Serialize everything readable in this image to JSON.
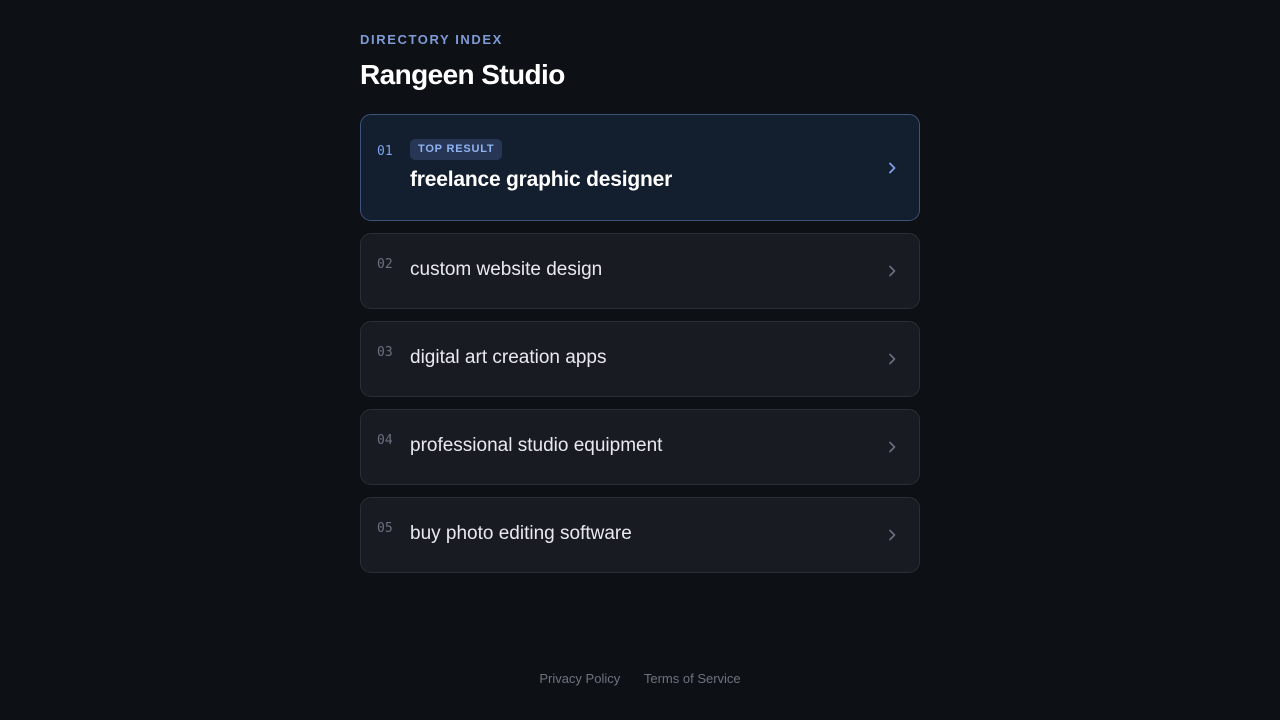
{
  "header": {
    "eyebrow": "DIRECTORY INDEX",
    "title": "Rangeen Studio"
  },
  "results": [
    {
      "number": "01",
      "badge": "TOP RESULT",
      "label": "freelance graphic designer"
    },
    {
      "number": "02",
      "label": "custom website design"
    },
    {
      "number": "03",
      "label": "digital art creation apps"
    },
    {
      "number": "04",
      "label": "professional studio equipment"
    },
    {
      "number": "05",
      "label": "buy photo editing software"
    }
  ],
  "icons": {
    "row_arrow": "chevron-right-icon"
  },
  "colors": {
    "background": "#0d1014",
    "accent": "#7fa3e8",
    "card": "#181b22",
    "card_top": "#131e2e"
  },
  "footer": {
    "links": [
      "Privacy Policy",
      "Terms of Service"
    ]
  }
}
